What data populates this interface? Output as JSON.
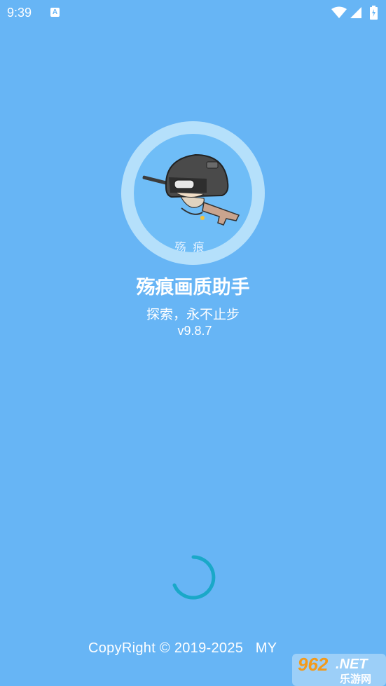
{
  "status_bar": {
    "time": "9:39",
    "notification_icon": "a-letter-icon",
    "notification_glyph": "A",
    "icons": [
      "wifi-icon",
      "signal-icon",
      "battery-charging-icon"
    ]
  },
  "splash": {
    "logo_icon": "helmet-character-logo",
    "logo_caption": "殇痕",
    "app_name": "殇痕画质助手",
    "slogan": "探索，永不止步",
    "version": "v9.8.7",
    "loading_icon": "loading-spinner-icon",
    "copyright": "CopyRight © 2019-2025   MY"
  },
  "watermark": {
    "brand": "962.NET",
    "subtitle": "乐游网"
  },
  "colors": {
    "background": "#67b5f5",
    "logo_ring": "#b5e0fb",
    "spinner": "#1aa8c8"
  }
}
